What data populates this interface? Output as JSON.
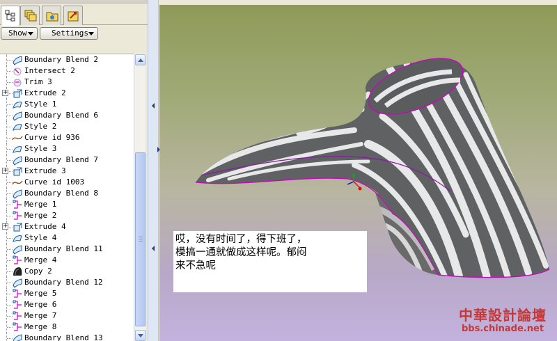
{
  "toolbar": {
    "tabs": [
      {
        "name": "model-tree-tab",
        "icon": "model-tree-icon"
      },
      {
        "name": "layers-tab",
        "icon": "layers-icon"
      },
      {
        "name": "folder-browser-tab",
        "icon": "folder-icon"
      },
      {
        "name": "favorites-tab",
        "icon": "favorites-icon"
      }
    ],
    "show_label": "Show",
    "settings_label": "Settings"
  },
  "tree": {
    "items": [
      {
        "label": "Boundary Blend 2",
        "icon": "boundary-blend-icon",
        "expandable": false
      },
      {
        "label": "Intersect 2",
        "icon": "intersect-icon",
        "expandable": false
      },
      {
        "label": "Trim 3",
        "icon": "trim-icon",
        "expandable": false
      },
      {
        "label": "Extrude 2",
        "icon": "extrude-icon",
        "expandable": true
      },
      {
        "label": "Style 1",
        "icon": "style-icon",
        "expandable": false
      },
      {
        "label": "Boundary Blend 6",
        "icon": "boundary-blend-icon",
        "expandable": false
      },
      {
        "label": "Style 2",
        "icon": "style-icon",
        "expandable": false
      },
      {
        "label": "Curve id 936",
        "icon": "curve-icon",
        "expandable": false
      },
      {
        "label": "Style 3",
        "icon": "style-icon",
        "expandable": false
      },
      {
        "label": "Boundary Blend 7",
        "icon": "boundary-blend-icon",
        "expandable": false
      },
      {
        "label": "Extrude 3",
        "icon": "extrude-icon",
        "expandable": true
      },
      {
        "label": "Curve id 1003",
        "icon": "curve-icon",
        "expandable": false
      },
      {
        "label": "Boundary Blend 8",
        "icon": "boundary-blend-icon",
        "expandable": false
      },
      {
        "label": "Merge 1",
        "icon": "merge-icon",
        "expandable": false
      },
      {
        "label": "Merge 2",
        "icon": "merge-icon",
        "expandable": false
      },
      {
        "label": "Extrude 4",
        "icon": "extrude-icon",
        "expandable": true
      },
      {
        "label": "Style 4",
        "icon": "style-icon",
        "expandable": false
      },
      {
        "label": "Boundary Blend 11",
        "icon": "boundary-blend-icon",
        "expandable": false
      },
      {
        "label": "Merge 4",
        "icon": "merge-icon",
        "expandable": false
      },
      {
        "label": "Copy 2",
        "icon": "copy-icon",
        "expandable": false
      },
      {
        "label": "Boundary Blend 12",
        "icon": "boundary-blend-icon",
        "expandable": false
      },
      {
        "label": "Merge 5",
        "icon": "merge-icon",
        "expandable": false
      },
      {
        "label": "Merge 6",
        "icon": "merge-icon",
        "expandable": false
      },
      {
        "label": "Merge 7",
        "icon": "merge-icon",
        "expandable": false
      },
      {
        "label": "Merge 8",
        "icon": "merge-icon",
        "expandable": false
      },
      {
        "label": "Boundary Blend 13",
        "icon": "boundary-blend-icon",
        "expandable": false
      }
    ]
  },
  "note": {
    "lines": [
      "哎，没有时间了，得下班了，",
      "模搞一通就做成这样呢。郁闷",
      "来不急呢"
    ]
  },
  "watermark": {
    "title": "中華設計論壇",
    "url": "bbs.chinade.net"
  },
  "colors": {
    "viewport_top": "#8f9a58",
    "viewport_bottom": "#c3b2dd",
    "edge_highlight": "#d000c8",
    "watermark": "#c43838"
  }
}
